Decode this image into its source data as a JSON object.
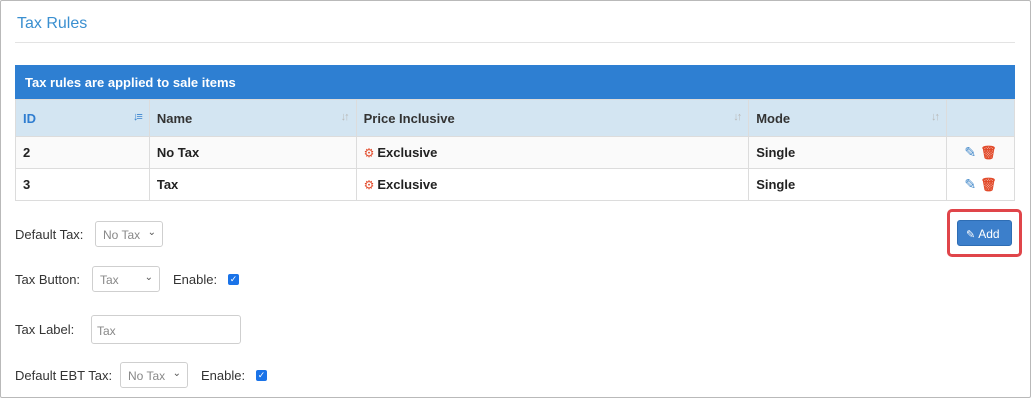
{
  "page": {
    "title": "Tax Rules"
  },
  "panel": {
    "heading": "Tax rules are applied to sale items"
  },
  "table": {
    "columns": [
      "ID",
      "Name",
      "Price Inclusive",
      "Mode"
    ],
    "rows": [
      {
        "id": "2",
        "name": "No Tax",
        "price_inclusive": "Exclusive",
        "mode": "Single"
      },
      {
        "id": "3",
        "name": "Tax",
        "price_inclusive": "Exclusive",
        "mode": "Single"
      }
    ],
    "row_actions": [
      "pencil-icon",
      "trash-icon"
    ]
  },
  "form": {
    "default_tax": {
      "label": "Default Tax:",
      "value": "No Tax"
    },
    "tax_button": {
      "label": "Tax Button:",
      "value": "Tax",
      "enable_label": "Enable:",
      "enabled": true
    },
    "tax_label": {
      "label": "Tax Label:",
      "placeholder": "Tax"
    },
    "default_ebt_tax": {
      "label": "Default EBT Tax:",
      "value": "No Tax",
      "enable_label": "Enable:",
      "enabled": true
    }
  },
  "toolbar": {
    "add_label": "Add"
  },
  "colors": {
    "accent": "#2e7fd2",
    "header_bg": "#d3e5f2",
    "danger": "#e24a2a",
    "highlight": "#e0454a"
  }
}
